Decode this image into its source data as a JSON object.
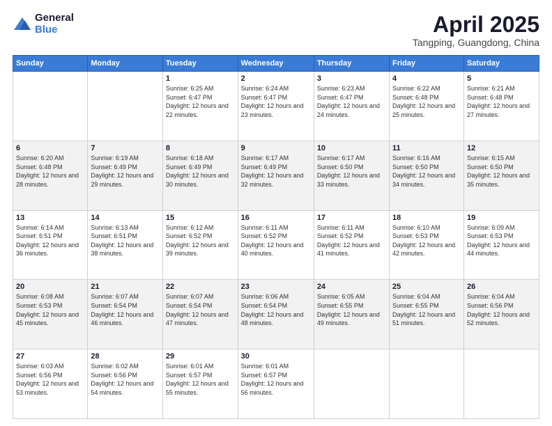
{
  "header": {
    "logo_general": "General",
    "logo_blue": "Blue",
    "title": "April 2025",
    "location": "Tangping, Guangdong, China"
  },
  "days_of_week": [
    "Sunday",
    "Monday",
    "Tuesday",
    "Wednesday",
    "Thursday",
    "Friday",
    "Saturday"
  ],
  "weeks": [
    {
      "shaded": false,
      "days": [
        {
          "num": "",
          "sunrise": "",
          "sunset": "",
          "daylight": ""
        },
        {
          "num": "",
          "sunrise": "",
          "sunset": "",
          "daylight": ""
        },
        {
          "num": "1",
          "sunrise": "Sunrise: 6:25 AM",
          "sunset": "Sunset: 6:47 PM",
          "daylight": "Daylight: 12 hours and 22 minutes."
        },
        {
          "num": "2",
          "sunrise": "Sunrise: 6:24 AM",
          "sunset": "Sunset: 6:47 PM",
          "daylight": "Daylight: 12 hours and 23 minutes."
        },
        {
          "num": "3",
          "sunrise": "Sunrise: 6:23 AM",
          "sunset": "Sunset: 6:47 PM",
          "daylight": "Daylight: 12 hours and 24 minutes."
        },
        {
          "num": "4",
          "sunrise": "Sunrise: 6:22 AM",
          "sunset": "Sunset: 6:48 PM",
          "daylight": "Daylight: 12 hours and 25 minutes."
        },
        {
          "num": "5",
          "sunrise": "Sunrise: 6:21 AM",
          "sunset": "Sunset: 6:48 PM",
          "daylight": "Daylight: 12 hours and 27 minutes."
        }
      ]
    },
    {
      "shaded": true,
      "days": [
        {
          "num": "6",
          "sunrise": "Sunrise: 6:20 AM",
          "sunset": "Sunset: 6:48 PM",
          "daylight": "Daylight: 12 hours and 28 minutes."
        },
        {
          "num": "7",
          "sunrise": "Sunrise: 6:19 AM",
          "sunset": "Sunset: 6:49 PM",
          "daylight": "Daylight: 12 hours and 29 minutes."
        },
        {
          "num": "8",
          "sunrise": "Sunrise: 6:18 AM",
          "sunset": "Sunset: 6:49 PM",
          "daylight": "Daylight: 12 hours and 30 minutes."
        },
        {
          "num": "9",
          "sunrise": "Sunrise: 6:17 AM",
          "sunset": "Sunset: 6:49 PM",
          "daylight": "Daylight: 12 hours and 32 minutes."
        },
        {
          "num": "10",
          "sunrise": "Sunrise: 6:17 AM",
          "sunset": "Sunset: 6:50 PM",
          "daylight": "Daylight: 12 hours and 33 minutes."
        },
        {
          "num": "11",
          "sunrise": "Sunrise: 6:16 AM",
          "sunset": "Sunset: 6:50 PM",
          "daylight": "Daylight: 12 hours and 34 minutes."
        },
        {
          "num": "12",
          "sunrise": "Sunrise: 6:15 AM",
          "sunset": "Sunset: 6:50 PM",
          "daylight": "Daylight: 12 hours and 35 minutes."
        }
      ]
    },
    {
      "shaded": false,
      "days": [
        {
          "num": "13",
          "sunrise": "Sunrise: 6:14 AM",
          "sunset": "Sunset: 6:51 PM",
          "daylight": "Daylight: 12 hours and 36 minutes."
        },
        {
          "num": "14",
          "sunrise": "Sunrise: 6:13 AM",
          "sunset": "Sunset: 6:51 PM",
          "daylight": "Daylight: 12 hours and 38 minutes."
        },
        {
          "num": "15",
          "sunrise": "Sunrise: 6:12 AM",
          "sunset": "Sunset: 6:52 PM",
          "daylight": "Daylight: 12 hours and 39 minutes."
        },
        {
          "num": "16",
          "sunrise": "Sunrise: 6:11 AM",
          "sunset": "Sunset: 6:52 PM",
          "daylight": "Daylight: 12 hours and 40 minutes."
        },
        {
          "num": "17",
          "sunrise": "Sunrise: 6:11 AM",
          "sunset": "Sunset: 6:52 PM",
          "daylight": "Daylight: 12 hours and 41 minutes."
        },
        {
          "num": "18",
          "sunrise": "Sunrise: 6:10 AM",
          "sunset": "Sunset: 6:53 PM",
          "daylight": "Daylight: 12 hours and 42 minutes."
        },
        {
          "num": "19",
          "sunrise": "Sunrise: 6:09 AM",
          "sunset": "Sunset: 6:53 PM",
          "daylight": "Daylight: 12 hours and 44 minutes."
        }
      ]
    },
    {
      "shaded": true,
      "days": [
        {
          "num": "20",
          "sunrise": "Sunrise: 6:08 AM",
          "sunset": "Sunset: 6:53 PM",
          "daylight": "Daylight: 12 hours and 45 minutes."
        },
        {
          "num": "21",
          "sunrise": "Sunrise: 6:07 AM",
          "sunset": "Sunset: 6:54 PM",
          "daylight": "Daylight: 12 hours and 46 minutes."
        },
        {
          "num": "22",
          "sunrise": "Sunrise: 6:07 AM",
          "sunset": "Sunset: 6:54 PM",
          "daylight": "Daylight: 12 hours and 47 minutes."
        },
        {
          "num": "23",
          "sunrise": "Sunrise: 6:06 AM",
          "sunset": "Sunset: 6:54 PM",
          "daylight": "Daylight: 12 hours and 48 minutes."
        },
        {
          "num": "24",
          "sunrise": "Sunrise: 6:05 AM",
          "sunset": "Sunset: 6:55 PM",
          "daylight": "Daylight: 12 hours and 49 minutes."
        },
        {
          "num": "25",
          "sunrise": "Sunrise: 6:04 AM",
          "sunset": "Sunset: 6:55 PM",
          "daylight": "Daylight: 12 hours and 51 minutes."
        },
        {
          "num": "26",
          "sunrise": "Sunrise: 6:04 AM",
          "sunset": "Sunset: 6:56 PM",
          "daylight": "Daylight: 12 hours and 52 minutes."
        }
      ]
    },
    {
      "shaded": false,
      "days": [
        {
          "num": "27",
          "sunrise": "Sunrise: 6:03 AM",
          "sunset": "Sunset: 6:56 PM",
          "daylight": "Daylight: 12 hours and 53 minutes."
        },
        {
          "num": "28",
          "sunrise": "Sunrise: 6:02 AM",
          "sunset": "Sunset: 6:56 PM",
          "daylight": "Daylight: 12 hours and 54 minutes."
        },
        {
          "num": "29",
          "sunrise": "Sunrise: 6:01 AM",
          "sunset": "Sunset: 6:57 PM",
          "daylight": "Daylight: 12 hours and 55 minutes."
        },
        {
          "num": "30",
          "sunrise": "Sunrise: 6:01 AM",
          "sunset": "Sunset: 6:57 PM",
          "daylight": "Daylight: 12 hours and 56 minutes."
        },
        {
          "num": "",
          "sunrise": "",
          "sunset": "",
          "daylight": ""
        },
        {
          "num": "",
          "sunrise": "",
          "sunset": "",
          "daylight": ""
        },
        {
          "num": "",
          "sunrise": "",
          "sunset": "",
          "daylight": ""
        }
      ]
    }
  ]
}
